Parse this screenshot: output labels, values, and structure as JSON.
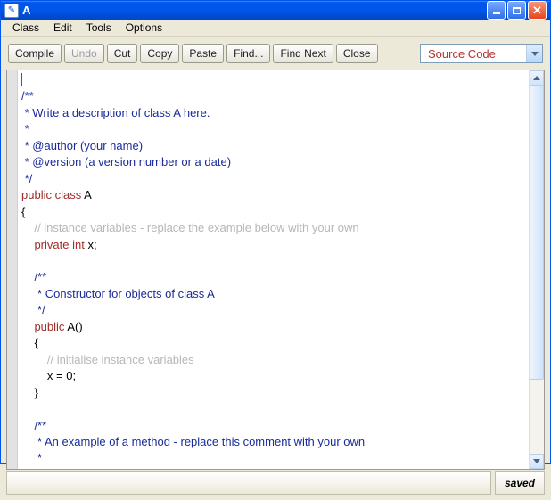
{
  "window": {
    "title": "A"
  },
  "menu": {
    "items": [
      "Class",
      "Edit",
      "Tools",
      "Options"
    ]
  },
  "toolbar": {
    "compile": "Compile",
    "undo": "Undo",
    "cut": "Cut",
    "copy": "Copy",
    "paste": "Paste",
    "find": "Find...",
    "find_next": "Find Next",
    "close": "Close"
  },
  "view_selector": {
    "value": "Source Code"
  },
  "code": {
    "tokens": [
      [
        "",
        ""
      ],
      [
        "navy",
        "/**"
      ],
      [
        "navy",
        " * Write a description of class A here."
      ],
      [
        "navy",
        " * "
      ],
      [
        "navy",
        " * @author (your name) "
      ],
      [
        "navy",
        " * @version (a version number or a date)"
      ],
      [
        "navy",
        " */"
      ],
      [
        [
          "red",
          "public "
        ],
        [
          "red",
          "class "
        ],
        [
          "black",
          "A"
        ]
      ],
      [
        "black",
        "{"
      ],
      [
        [
          "black",
          "    "
        ],
        [
          "grey",
          "// instance variables - replace the example below with your own"
        ]
      ],
      [
        [
          "black",
          "    "
        ],
        [
          "red",
          "private "
        ],
        [
          "red",
          "int "
        ],
        [
          "black",
          "x;"
        ]
      ],
      [
        "",
        ""
      ],
      [
        "navy",
        "    /**"
      ],
      [
        "navy",
        "     * Constructor for objects of class A"
      ],
      [
        "navy",
        "     */"
      ],
      [
        [
          "black",
          "    "
        ],
        [
          "red",
          "public "
        ],
        [
          "black",
          "A()"
        ]
      ],
      [
        "black",
        "    {"
      ],
      [
        [
          "black",
          "        "
        ],
        [
          "grey",
          "// initialise instance variables"
        ]
      ],
      [
        "black",
        "        x = 0;"
      ],
      [
        "black",
        "    }"
      ],
      [
        "",
        ""
      ],
      [
        "navy",
        "    /**"
      ],
      [
        "navy",
        "     * An example of a method - replace this comment with your own"
      ],
      [
        "navy",
        "     * "
      ]
    ]
  },
  "status": {
    "saved": "saved"
  }
}
